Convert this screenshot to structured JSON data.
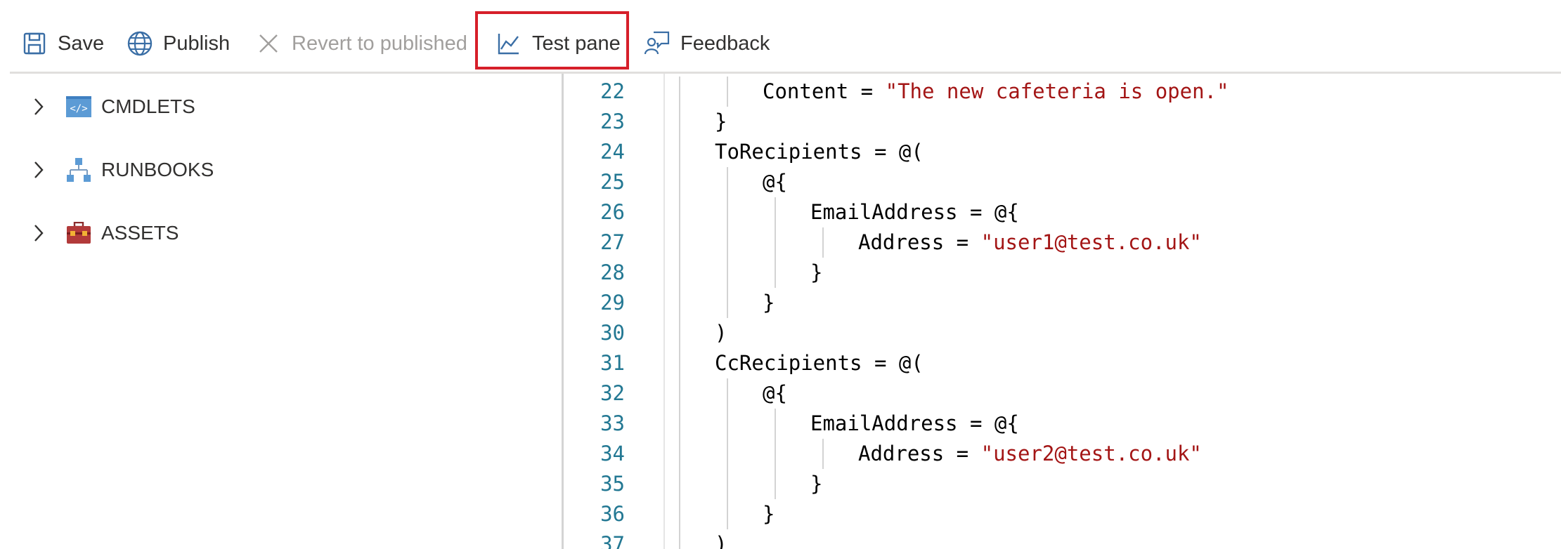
{
  "toolbar": {
    "save_label": "Save",
    "publish_label": "Publish",
    "revert_label": "Revert to published",
    "test_pane_label": "Test pane",
    "feedback_label": "Feedback"
  },
  "tree": {
    "items": [
      {
        "label": "CMDLETS",
        "icon": "code-icon"
      },
      {
        "label": "RUNBOOKS",
        "icon": "hierarchy-icon"
      },
      {
        "label": "ASSETS",
        "icon": "toolbox-icon"
      }
    ]
  },
  "editor": {
    "lines": [
      {
        "num": "22",
        "pre": "Content = ",
        "str": "\"The new cafeteria is open.\"",
        "post": ""
      },
      {
        "num": "23",
        "pre": "}",
        "str": "",
        "post": ""
      },
      {
        "num": "24",
        "pre": "ToRecipients = @(",
        "str": "",
        "post": ""
      },
      {
        "num": "25",
        "pre": "@{",
        "str": "",
        "post": ""
      },
      {
        "num": "26",
        "pre": "EmailAddress = @{",
        "str": "",
        "post": ""
      },
      {
        "num": "27",
        "pre": "Address = ",
        "str": "\"user1@test.co.uk\"",
        "post": ""
      },
      {
        "num": "28",
        "pre": "}",
        "str": "",
        "post": ""
      },
      {
        "num": "29",
        "pre": "}",
        "str": "",
        "post": ""
      },
      {
        "num": "30",
        "pre": ")",
        "str": "",
        "post": ""
      },
      {
        "num": "31",
        "pre": "CcRecipients = @(",
        "str": "",
        "post": ""
      },
      {
        "num": "32",
        "pre": "@{",
        "str": "",
        "post": ""
      },
      {
        "num": "33",
        "pre": "EmailAddress = @{",
        "str": "",
        "post": ""
      },
      {
        "num": "34",
        "pre": "Address = ",
        "str": "\"user2@test.co.uk\"",
        "post": ""
      },
      {
        "num": "35",
        "pre": "}",
        "str": "",
        "post": ""
      },
      {
        "num": "36",
        "pre": "}",
        "str": "",
        "post": ""
      },
      {
        "num": "37",
        "pre": ")",
        "str": "",
        "post": ""
      }
    ]
  },
  "colors": {
    "highlight": "#d61f2a",
    "line_number": "#237893",
    "string": "#a31515",
    "icon_blue": "#3a6ea5"
  }
}
